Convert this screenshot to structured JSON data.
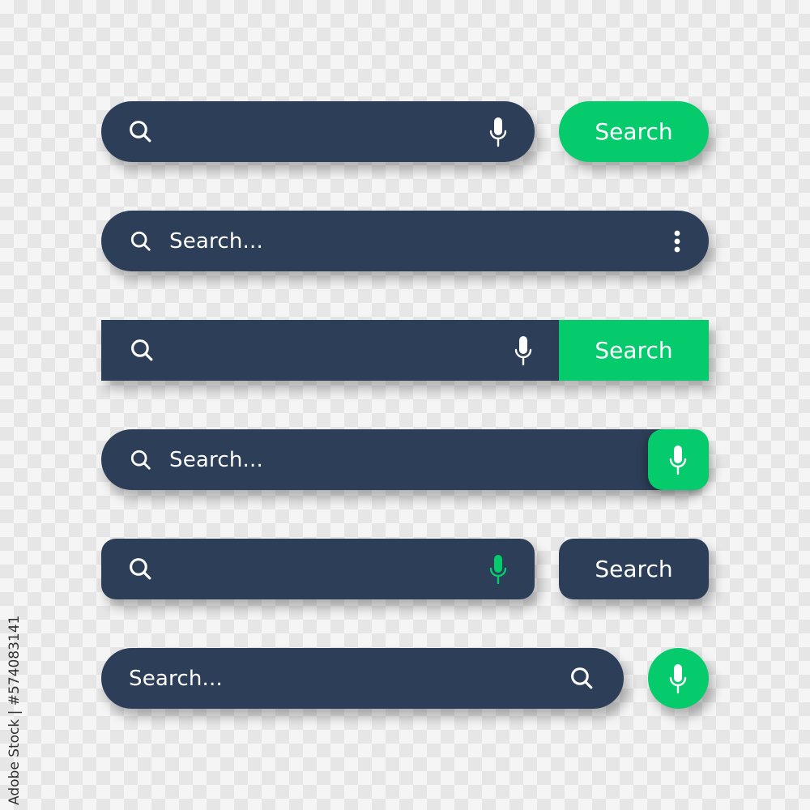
{
  "colors": {
    "bar": "#2d3f58",
    "accent": "#06cb6c",
    "text": "#ffffff"
  },
  "rows": [
    {
      "variant": "pill-input-with-mic-and-green-pill-button",
      "input": {
        "placeholder": "",
        "icons": [
          "search-icon",
          "mic-icon"
        ]
      },
      "button": {
        "label": "Search"
      }
    },
    {
      "variant": "pill-input-with-placeholder-and-menu",
      "input": {
        "placeholder": "Search...",
        "icons": [
          "search-icon",
          "more-vertical-icon"
        ]
      }
    },
    {
      "variant": "square-input-with-mic-and-attached-green-button",
      "input": {
        "placeholder": "",
        "icons": [
          "search-icon",
          "mic-icon"
        ]
      },
      "button": {
        "label": "Search"
      }
    },
    {
      "variant": "pill-input-with-placeholder-and-green-mic-button",
      "input": {
        "placeholder": "Search...",
        "icons": [
          "search-icon"
        ]
      },
      "button": {
        "icon": "mic-icon"
      }
    },
    {
      "variant": "rounded-input-with-green-mic-and-dark-button",
      "input": {
        "placeholder": "",
        "icons": [
          "search-icon",
          "mic-icon"
        ]
      },
      "button": {
        "label": "Search"
      }
    },
    {
      "variant": "pill-input-with-trailing-search-and-circle-mic",
      "input": {
        "placeholder": "Search...",
        "icons": [
          "search-icon"
        ]
      },
      "button": {
        "icon": "mic-icon"
      }
    }
  ],
  "watermark": "Adobe Stock | #574083141"
}
